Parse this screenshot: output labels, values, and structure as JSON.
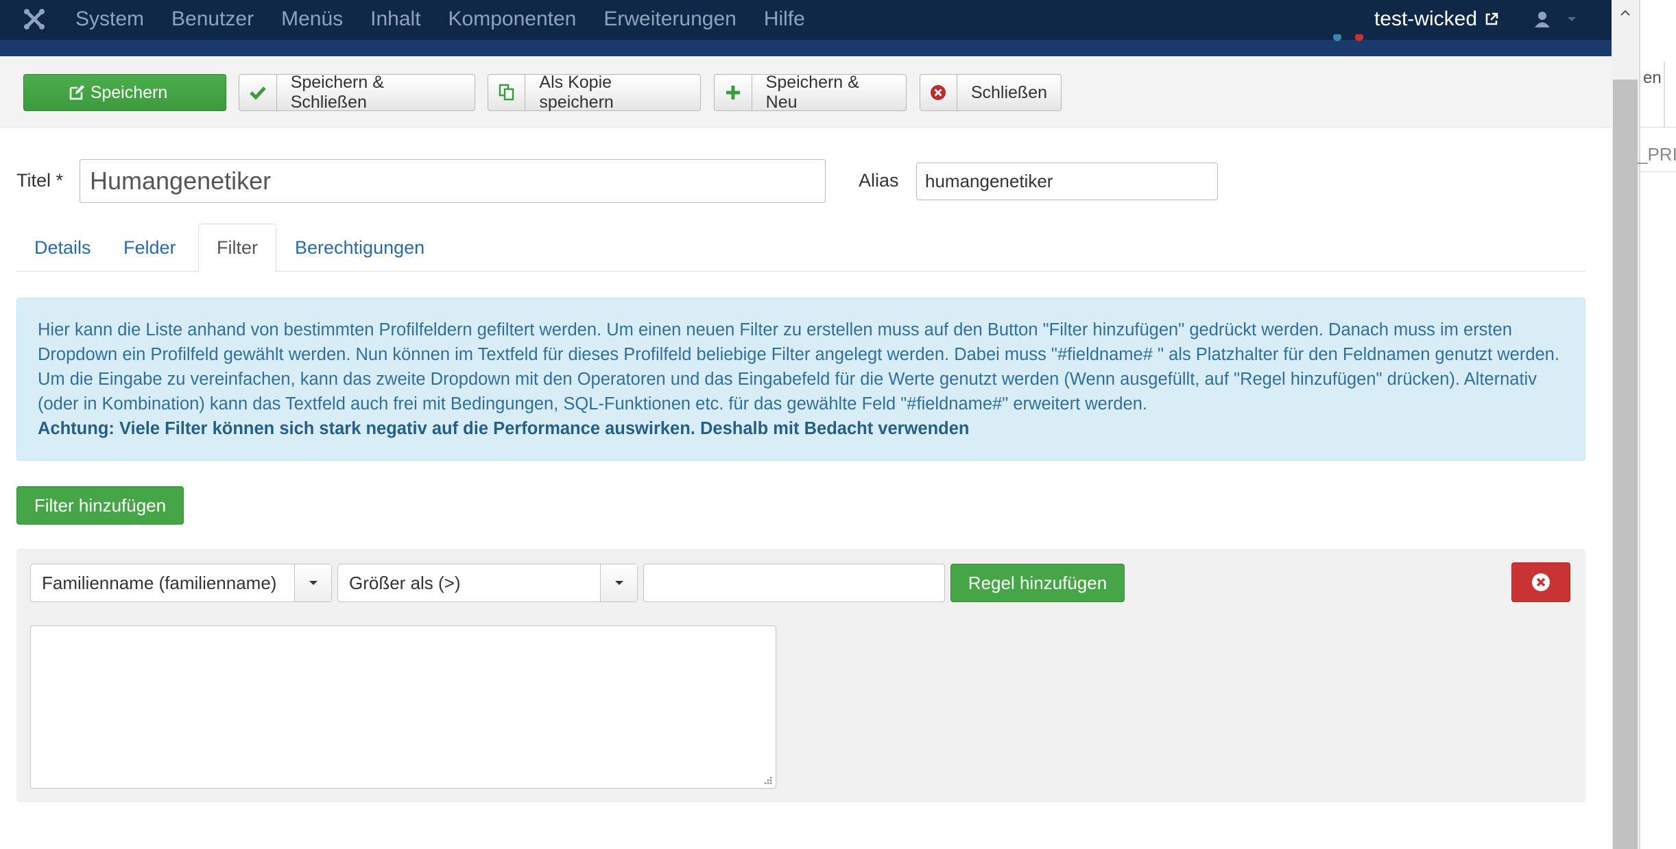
{
  "nav": {
    "items": [
      "System",
      "Benutzer",
      "Menüs",
      "Inhalt",
      "Komponenten",
      "Erweiterungen",
      "Hilfe"
    ],
    "site_name": "test-wicked"
  },
  "toolbar": {
    "save": "Speichern",
    "save_close": "Speichern & Schließen",
    "save_copy": "Als Kopie speichern",
    "save_new": "Speichern & Neu",
    "close": "Schließen"
  },
  "form": {
    "title_label": "Titel *",
    "title_value": "Humangenetiker",
    "alias_label": "Alias",
    "alias_value": "humangenetiker"
  },
  "tabs": [
    "Details",
    "Felder",
    "Filter",
    "Berechtigungen"
  ],
  "active_tab": "Filter",
  "info": {
    "text": "Hier kann die Liste anhand von bestimmten Profilfeldern gefiltert werden. Um einen neuen Filter zu erstellen muss auf den Button \"Filter hinzufügen\" gedrückt werden. Danach muss im ersten Dropdown ein Profilfeld gewählt werden. Nun können im Textfeld für dieses Profilfeld beliebige Filter angelegt werden. Dabei muss \"#fieldname# \" als Platzhalter für den Feldnamen genutzt werden. Um die Eingabe zu vereinfachen, kann das zweite Dropdown mit den Operatoren und das Eingabefeld für die Werte genutzt werden (Wenn ausgefüllt, auf \"Regel hinzufügen\" drücken). Alternativ (oder in Kombination) kann das Textfeld auch frei mit Bedingungen, SQL-Funktionen etc. für das gewählte Feld \"#fieldname#\" erweitert werden.",
    "warning": "Achtung: Viele Filter können sich stark negativ auf die Performance auswirken. Deshalb mit Bedacht verwenden"
  },
  "add_filter_label": "Filter hinzufügen",
  "filter": {
    "field_select": "Familienname (familienname)",
    "operator_select": "Größer als (>)",
    "value": "",
    "add_rule_label": "Regel hinzufügen"
  },
  "right_pane": {
    "text1": "en",
    "text2": "_PRIV"
  },
  "colors": {
    "navbar": "#102847",
    "success": "#46a546",
    "danger": "#c93333",
    "info_bg": "#d9edf7",
    "link": "#2a69a8"
  }
}
